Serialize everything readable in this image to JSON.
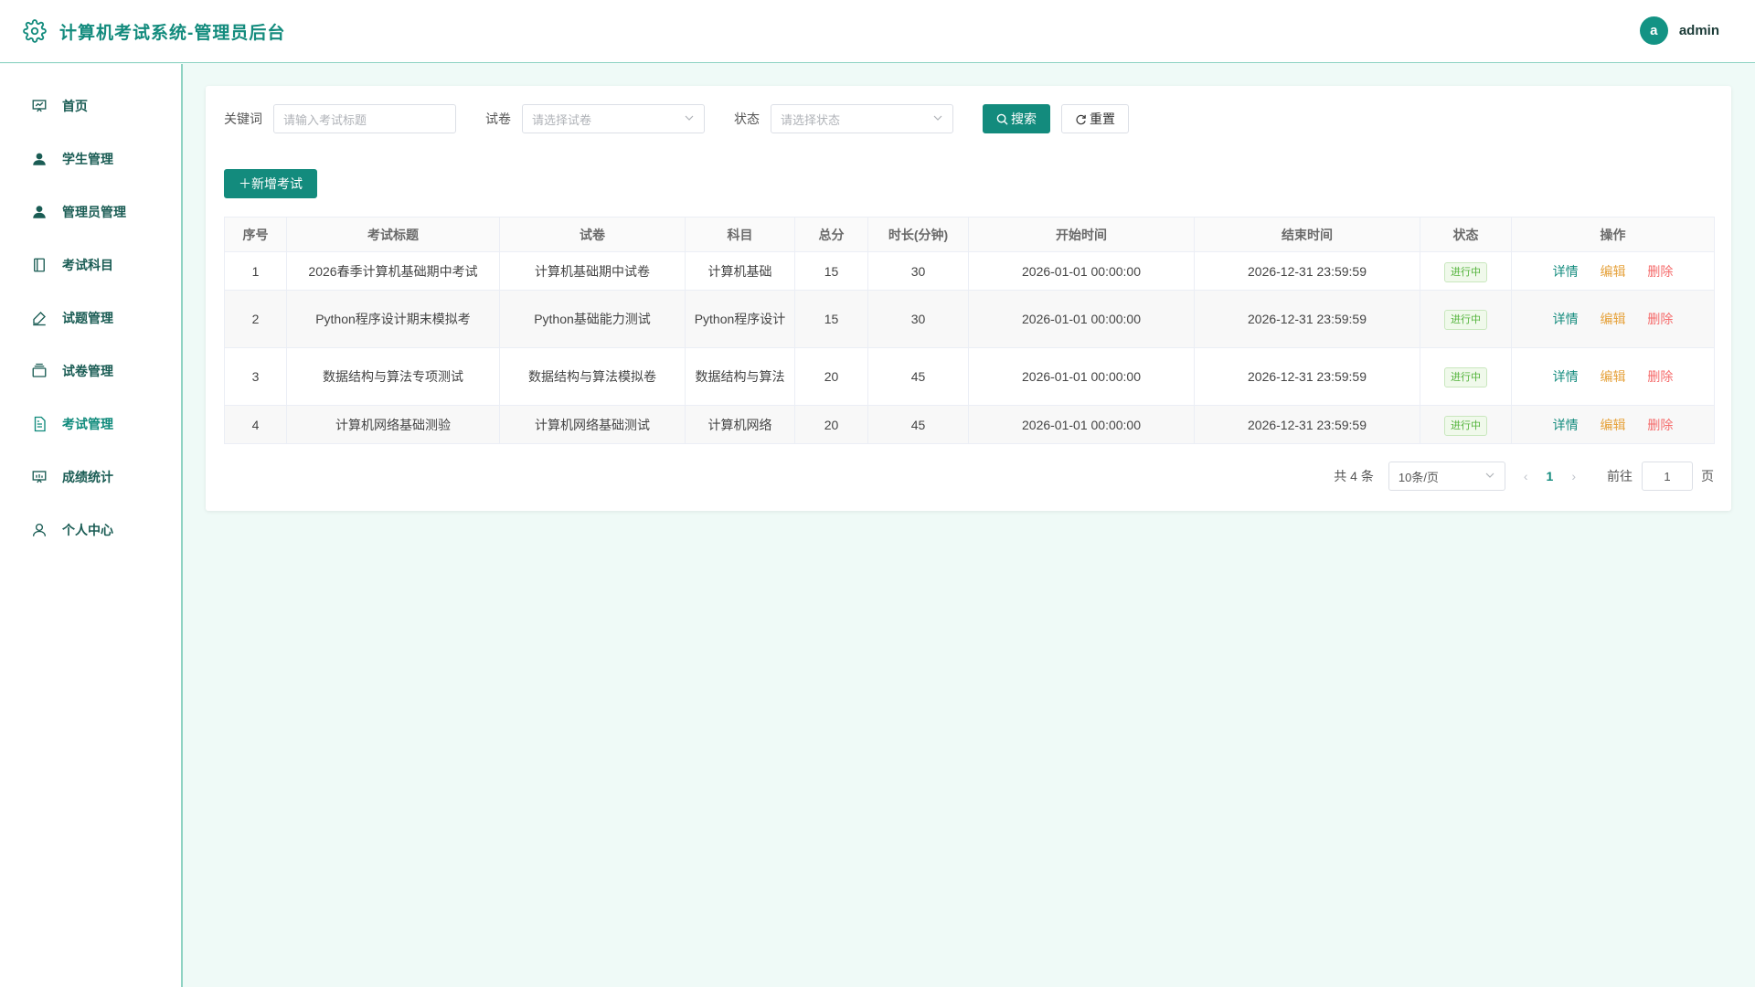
{
  "header": {
    "title": "计算机考试系统-管理员后台",
    "avatar_letter": "a",
    "username": "admin"
  },
  "sidebar": {
    "items": [
      {
        "label": "首页",
        "icon": "dashboard-icon"
      },
      {
        "label": "学生管理",
        "icon": "user-icon"
      },
      {
        "label": "管理员管理",
        "icon": "admin-icon"
      },
      {
        "label": "考试科目",
        "icon": "book-icon"
      },
      {
        "label": "试题管理",
        "icon": "edit-icon"
      },
      {
        "label": "试卷管理",
        "icon": "paper-icon"
      },
      {
        "label": "考试管理",
        "icon": "document-icon",
        "active": true
      },
      {
        "label": "成绩统计",
        "icon": "chart-icon"
      },
      {
        "label": "个人中心",
        "icon": "profile-icon"
      }
    ]
  },
  "filters": {
    "keyword_label": "关键词",
    "keyword_placeholder": "请输入考试标题",
    "paper_label": "试卷",
    "paper_placeholder": "请选择试卷",
    "status_label": "状态",
    "status_placeholder": "请选择状态",
    "search_label": "搜索",
    "reset_label": "重置"
  },
  "add_button": "＋新增考试",
  "table": {
    "headers": [
      "序号",
      "考试标题",
      "试卷",
      "科目",
      "总分",
      "时长(分钟)",
      "开始时间",
      "结束时间",
      "状态",
      "操作"
    ],
    "rows": [
      {
        "no": "1",
        "title": "2026春季计算机基础期中考试",
        "paper": "计算机基础期中试卷",
        "subject": "计算机基础",
        "score": "15",
        "duration": "30",
        "start": "2026-01-01 00:00:00",
        "end": "2026-12-31 23:59:59",
        "status": "进行中"
      },
      {
        "no": "2",
        "title": "Python程序设计期末模拟考",
        "paper": "Python基础能力测试",
        "subject": "Python程序设计",
        "score": "15",
        "duration": "30",
        "start": "2026-01-01 00:00:00",
        "end": "2026-12-31 23:59:59",
        "status": "进行中"
      },
      {
        "no": "3",
        "title": "数据结构与算法专项测试",
        "paper": "数据结构与算法模拟卷",
        "subject": "数据结构与算法",
        "score": "20",
        "duration": "45",
        "start": "2026-01-01 00:00:00",
        "end": "2026-12-31 23:59:59",
        "status": "进行中"
      },
      {
        "no": "4",
        "title": "计算机网络基础测验",
        "paper": "计算机网络基础测试",
        "subject": "计算机网络",
        "score": "20",
        "duration": "45",
        "start": "2026-01-01 00:00:00",
        "end": "2026-12-31 23:59:59",
        "status": "进行中"
      }
    ],
    "ops": {
      "detail": "详情",
      "edit": "编辑",
      "delete": "删除"
    }
  },
  "pagination": {
    "total": "共 4 条",
    "page_size": "10条/页",
    "current_page": "1",
    "goto_label": "前往",
    "goto_value": "1",
    "page_unit": "页"
  },
  "colors": {
    "accent": "#138b7d",
    "success": "#52b33a",
    "warning": "#e6a23c",
    "danger": "#f56c6c",
    "background": "#effaf7"
  }
}
